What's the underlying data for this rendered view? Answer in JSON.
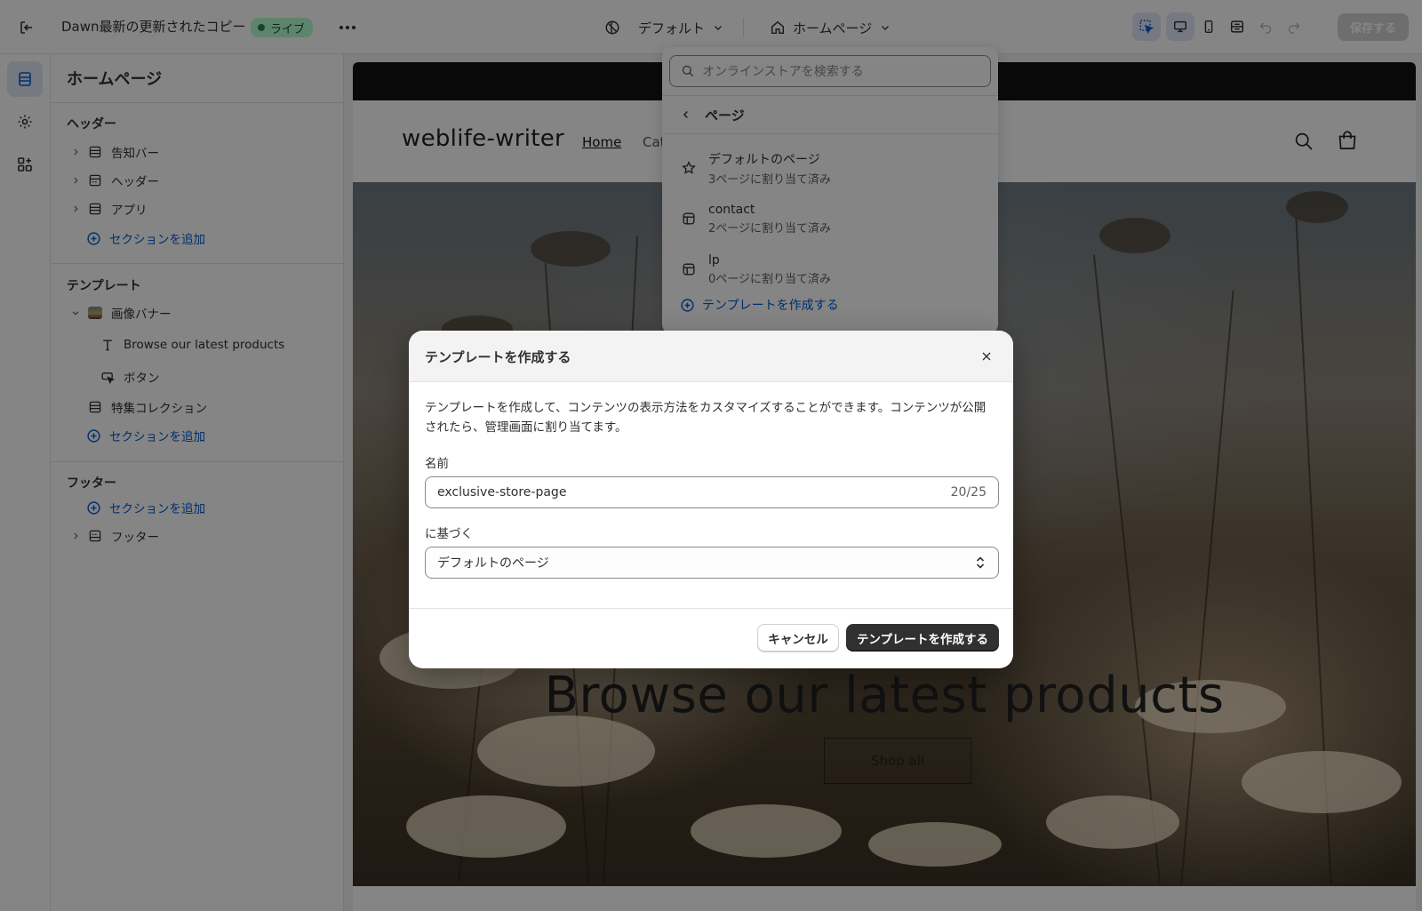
{
  "topbar": {
    "theme_name": "Dawn最新の更新されたコピー",
    "live_badge": "ライブ",
    "theme_select": "デフォルト",
    "page_select": "ホームページ",
    "save_label": "保存する"
  },
  "sidebar": {
    "title": "ホームページ",
    "groups": [
      {
        "title": "ヘッダー",
        "items": [
          "告知バー",
          "ヘッダー",
          "アプリ"
        ],
        "add_label": "セクションを追加"
      },
      {
        "title": "テンプレート",
        "section": "画像バナー",
        "blocks": [
          "Browse our latest products",
          "ボタン"
        ],
        "items": [
          "特集コレクション"
        ],
        "add_label": "セクションを追加"
      },
      {
        "title": "フッター",
        "add_label": "セクションを追加",
        "items": [
          "フッター"
        ]
      }
    ]
  },
  "preview": {
    "store_name": "weblife-writer",
    "nav": [
      "Home",
      "Cat"
    ],
    "hero_heading": "Browse our latest products",
    "hero_button": "Shop all"
  },
  "dropdown": {
    "search_placeholder": "オンラインストアを検索する",
    "back_label": "ページ",
    "items": [
      {
        "name": "デフォルトのページ",
        "sub": "3ページに割り当て済み"
      },
      {
        "name": "contact",
        "sub": "2ページに割り当て済み"
      },
      {
        "name": "lp",
        "sub": "0ページに割り当て済み"
      }
    ],
    "create_label": "テンプレートを作成する"
  },
  "modal": {
    "title": "テンプレートを作成する",
    "description": "テンプレートを作成して、コンテンツの表示方法をカスタマイズすることができます。コンテンツが公開されたら、管理画面に割り当てます。",
    "name_label": "名前",
    "name_value": "exclusive-store-page",
    "name_count": "20/25",
    "based_on_label": "に基づく",
    "based_on_value": "デフォルトのページ",
    "cancel_label": "キャンセル",
    "create_label": "テンプレートを作成する"
  },
  "colors": {
    "accent_blue": "#005bd3",
    "live_green": "#b4fed2",
    "primary_button": "#303030"
  }
}
